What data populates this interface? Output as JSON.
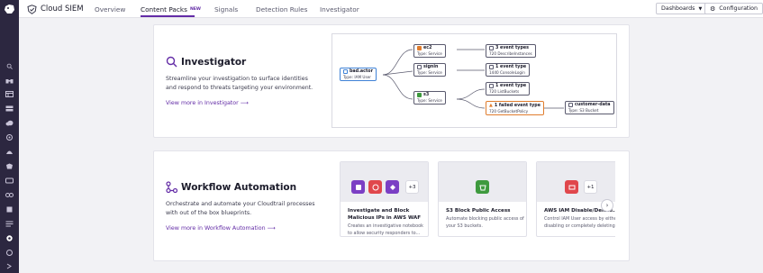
{
  "app": {
    "title": "Cloud SIEM"
  },
  "tabs": [
    {
      "label": "Overview",
      "active": false
    },
    {
      "label": "Content Packs",
      "active": true,
      "badge": "NEW"
    },
    {
      "label": "Signals",
      "active": false
    },
    {
      "label": "Detection Rules",
      "active": false
    },
    {
      "label": "Investigator",
      "active": false
    }
  ],
  "header": {
    "dashboards_label": "Dashboards",
    "configuration_label": "Configuration"
  },
  "colors": {
    "accent": "#632ca6",
    "rail": "#2c2740",
    "node_blue": "#3f82d6",
    "node_orange": "#e07d2e",
    "node_green": "#3e9a3e"
  },
  "investigator": {
    "title": "Investigator",
    "description": "Streamline your investigation to surface identities and respond to threats targeting your environment.",
    "link": "View more in Investigator",
    "graph": {
      "root": {
        "name": "bad.actor",
        "type": "Type: IAM User"
      },
      "services": [
        {
          "name": "ec2",
          "type": "Type: Service"
        },
        {
          "name": "signin",
          "type": "Type: Service"
        },
        {
          "name": "s3",
          "type": "Type: Service"
        }
      ],
      "events": [
        {
          "name": "3 event types",
          "detail": "720 DescribeInstances"
        },
        {
          "name": "1 event type",
          "detail": "1440 ConsoleLogin"
        },
        {
          "name": "1 event type",
          "detail": "720 ListBuckets"
        },
        {
          "name": "1 failed event type",
          "detail": "720 GetBucketPolicy"
        }
      ],
      "target": {
        "name": "customer-data",
        "type": "Type: S3 Bucket"
      }
    }
  },
  "workflow": {
    "title": "Workflow Automation",
    "description": "Orchestrate and automate your Cloudtrail processes with out of the box blueprints.",
    "link": "View more in Workflow Automation",
    "cards": [
      {
        "title": "Investigate and Block Malicious IPs in AWS WAF",
        "description": "Creates an investigative notebook to allow security responders to...",
        "extra_count": "+3"
      },
      {
        "title": "S3 Block Public Access",
        "description": "Automate blocking public access of your S3 buckets."
      },
      {
        "title": "AWS IAM Disable/Delete...",
        "description": "Control IAM User access by either disabling or completely deleting...",
        "extra_count": "+1"
      }
    ]
  }
}
